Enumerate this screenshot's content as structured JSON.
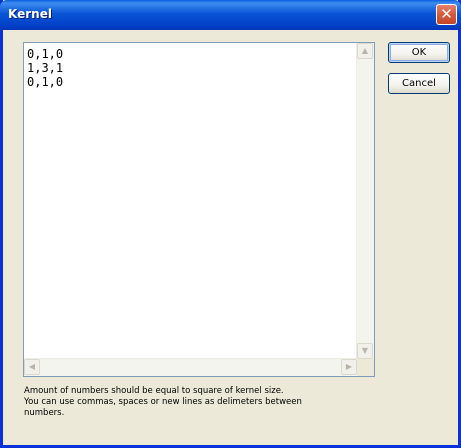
{
  "window": {
    "title": "Kernel",
    "close_glyph": "✕"
  },
  "editor": {
    "lines": [
      "0,1,0",
      "1,3,1",
      "0,1,0"
    ],
    "scroll_up_glyph": "▲",
    "scroll_down_glyph": "▼",
    "scroll_left_glyph": "◀",
    "scroll_right_glyph": "▶"
  },
  "buttons": {
    "ok_label": "OK",
    "cancel_label": "Cancel"
  },
  "help": {
    "line1": "Amount of numbers should be equal to square of kernel size.",
    "line2": "You can use commas, spaces or new lines as delimeters between",
    "line3": "numbers."
  },
  "colors": {
    "titlebar": "#0a55d6",
    "window_bg": "#ece9d8",
    "close_button": "#d55a3c"
  }
}
